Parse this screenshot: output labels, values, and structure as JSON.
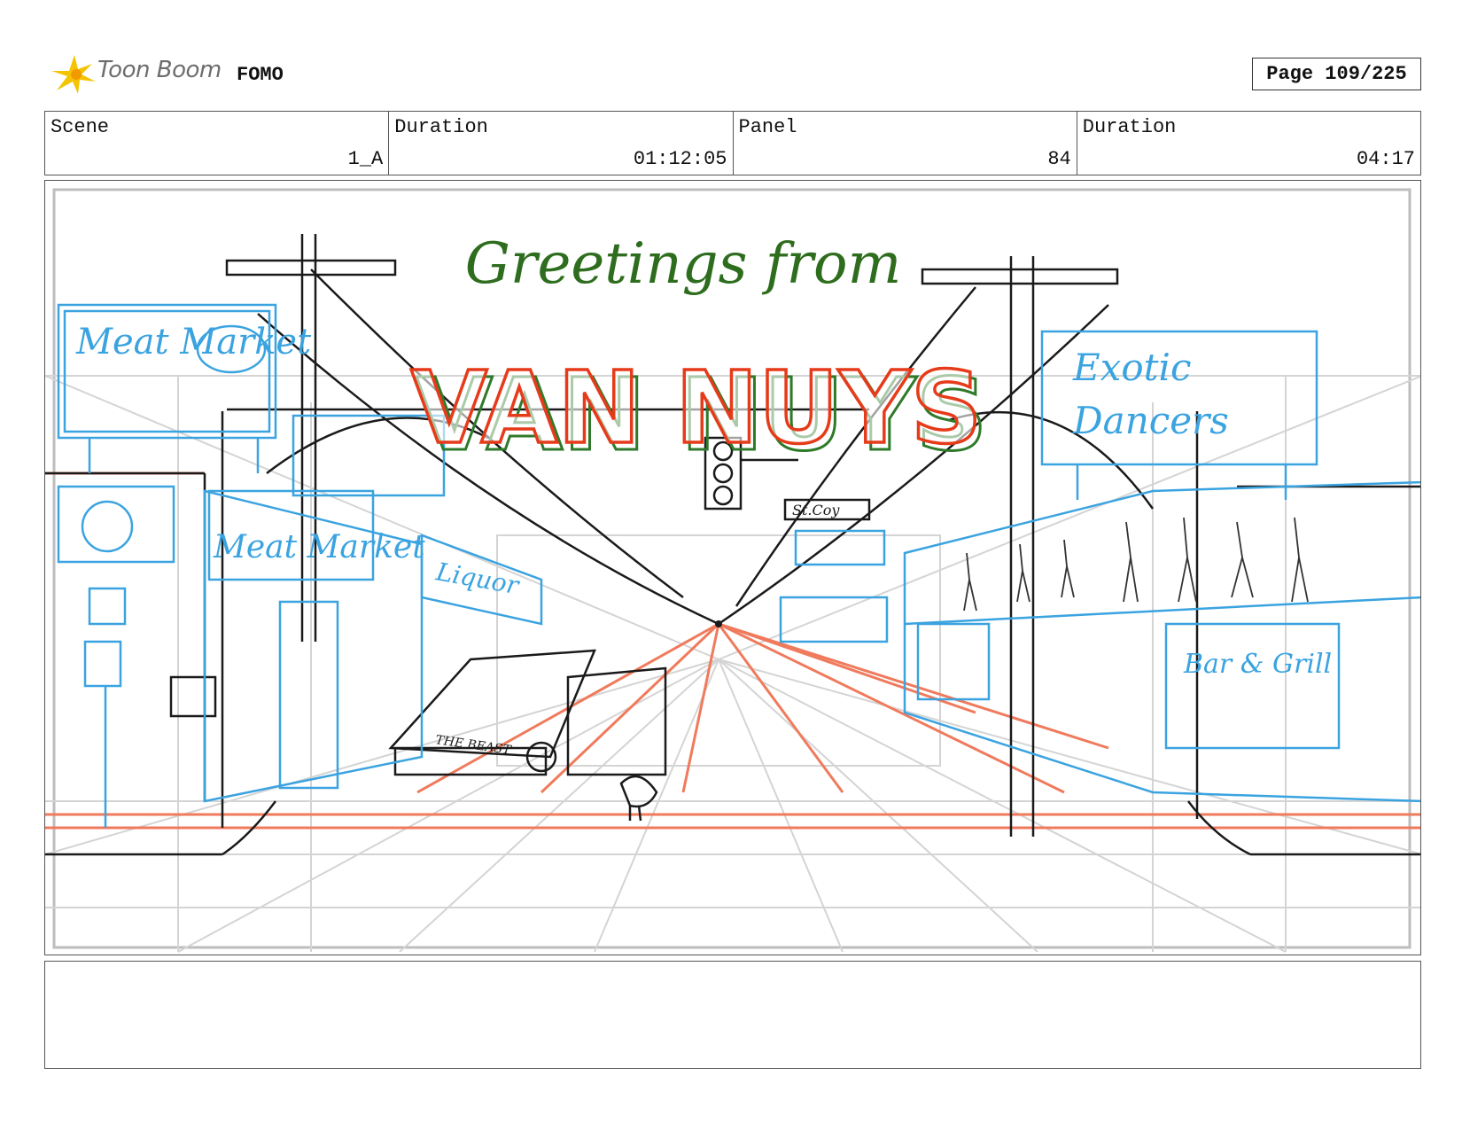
{
  "header": {
    "logo_text": "Toon Boom",
    "project_title": "FOMO",
    "page_label": "Page 109/225"
  },
  "info": {
    "scene_label": "Scene",
    "scene_value": "1_A",
    "scene_duration_label": "Duration",
    "scene_duration_value": "01:12:05",
    "panel_label": "Panel",
    "panel_value": "84",
    "panel_duration_label": "Duration",
    "panel_duration_value": "04:17"
  },
  "artwork": {
    "greeting": "Greetings from",
    "city_sign": "VAN NUYS",
    "left_billboard": "Meat Market",
    "left_storefront": "Meat Market",
    "liquor_sign": "Liquor",
    "right_billboard_line1": "Exotic",
    "right_billboard_line2": "Dancers",
    "bar_sign": "Bar & Grill",
    "street_sign": "St.Coy",
    "car_text": "THE BEAST",
    "colors": {
      "pencil": "#1a1a1a",
      "blue_layer": "#3aa3e0",
      "red_layer": "#f07a5c",
      "sign_red": "#e63b1a",
      "sign_green": "#2f7a2a",
      "greeting_green": "#2e6d1e",
      "grid_gray": "#cfcfcf"
    }
  },
  "notes": {
    "text": ""
  }
}
